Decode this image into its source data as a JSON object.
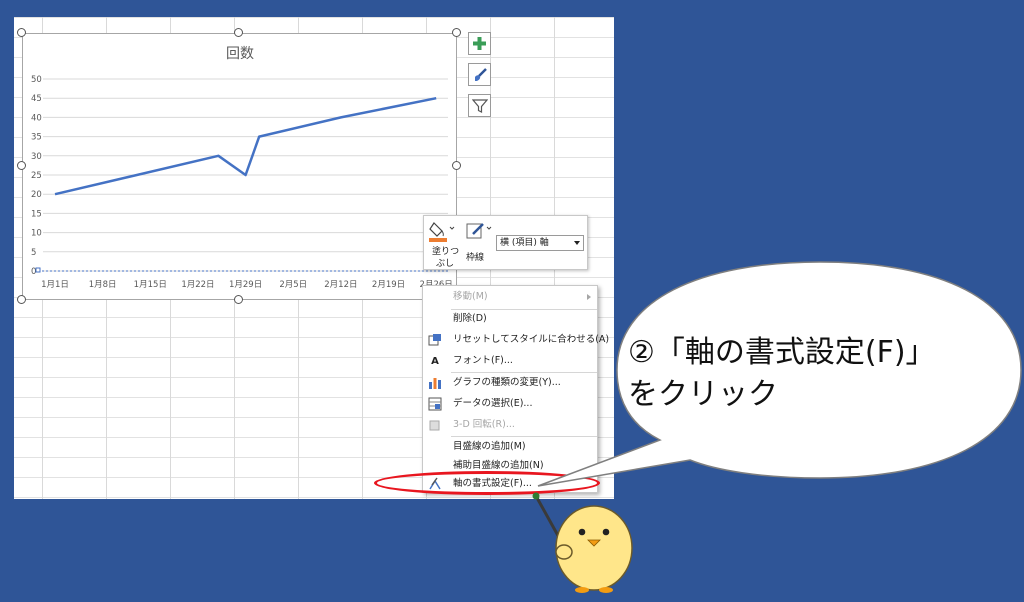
{
  "colors": {
    "background": "#2f5597",
    "series_line": "#4472c4",
    "highlight": "#e8161f",
    "fill_accent": "#ed7d31",
    "mascot": "#ffe68a"
  },
  "chart_data": {
    "type": "line",
    "title": "回数",
    "categories": [
      "1月1日",
      "1月8日",
      "1月15日",
      "1月22日",
      "1月29日",
      "2月5日",
      "2月12日",
      "2月19日",
      "2月26日"
    ],
    "x_points": [
      "1月1日",
      "1月25日",
      "1月29日",
      "1月31日",
      "2月12日",
      "2月26日"
    ],
    "values": [
      20,
      30,
      25,
      35,
      40,
      45
    ],
    "yticks": [
      "0",
      "5",
      "10",
      "15",
      "20",
      "25",
      "30",
      "35",
      "40",
      "45",
      "50"
    ],
    "ylim": [
      0,
      50
    ],
    "grid": true,
    "legend": false
  },
  "side_buttons": {
    "elements_icon": "plus-icon",
    "styles_icon": "paintbrush-icon",
    "filter_icon": "funnel-icon"
  },
  "mini_toolbar": {
    "fill_label_1": "塗りつ",
    "fill_label_2": "ぶし",
    "outline_label": "枠線",
    "element_select_value": "横 (項目) 軸"
  },
  "context_menu": {
    "items": [
      {
        "label": "移動(M)",
        "disabled": true,
        "icon": "none"
      },
      {
        "label": "削除(D)",
        "disabled": false,
        "icon": "none"
      },
      {
        "label": "リセットしてスタイルに合わせる(A)",
        "disabled": false,
        "icon": "reset-style-icon"
      },
      {
        "label": "フォント(F)...",
        "disabled": false,
        "icon": "font-icon",
        "icon_glyph": "A"
      },
      {
        "label": "グラフの種類の変更(Y)...",
        "disabled": false,
        "icon": "chart-type-icon"
      },
      {
        "label": "データの選択(E)...",
        "disabled": false,
        "icon": "select-data-icon"
      },
      {
        "label": "3-D 回転(R)...",
        "disabled": true,
        "icon": "rotate-3d-icon"
      },
      {
        "label": "目盛線の追加(M)",
        "disabled": false,
        "icon": "none"
      },
      {
        "label": "補助目盛線の追加(N)",
        "disabled": false,
        "icon": "none"
      },
      {
        "label": "軸の書式設定(F)...",
        "disabled": false,
        "icon": "format-axis-icon"
      }
    ]
  },
  "callout": {
    "line1": "②「軸の書式設定(F)」",
    "line2": "をクリック"
  }
}
